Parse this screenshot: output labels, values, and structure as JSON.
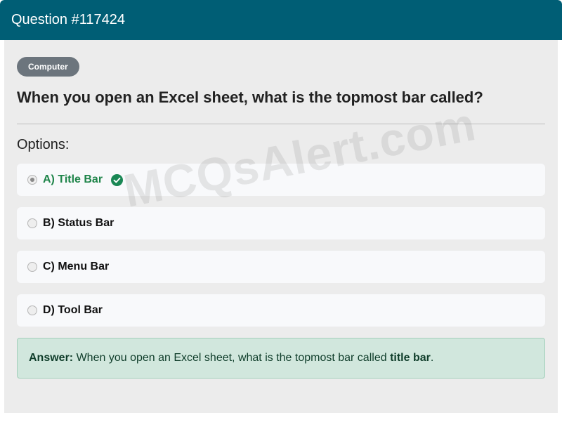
{
  "header": {
    "title": "Question #117424"
  },
  "badge": {
    "label": "Computer"
  },
  "question": {
    "text": "When you open an Excel sheet, what is the topmost bar called?"
  },
  "options_label": "Options:",
  "options": [
    {
      "label": "A) Title Bar",
      "selected": true,
      "correct": true
    },
    {
      "label": "B) Status Bar",
      "selected": false,
      "correct": false
    },
    {
      "label": "C) Menu Bar",
      "selected": false,
      "correct": false
    },
    {
      "label": "D) Tool Bar",
      "selected": false,
      "correct": false
    }
  ],
  "watermark": "MCQsAlert.com",
  "answer": {
    "prefix": "Answer:",
    "text": "When you open an Excel sheet, what is the topmost bar called",
    "highlight": "title bar",
    "suffix": "."
  },
  "colors": {
    "header_bg": "#005e75",
    "badge_bg": "#6c757d",
    "correct_text": "#1e8449",
    "check_icon": "#198754",
    "answer_bg": "#d1e7dd"
  }
}
